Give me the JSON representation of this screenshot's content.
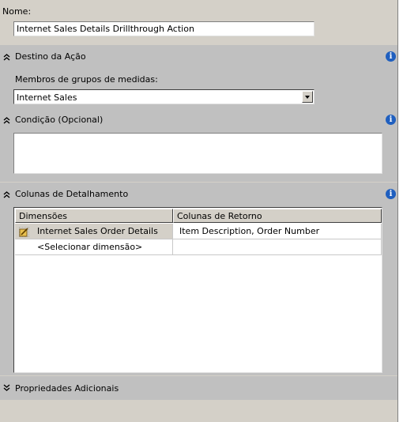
{
  "name": {
    "label": "Nome:",
    "value": "Internet Sales Details Drillthrough Action"
  },
  "target": {
    "title": "Destino da Ação",
    "field_label": "Membros de grupos de medidas:",
    "selected": "Internet Sales"
  },
  "condition": {
    "title": "Condição (Opcional)",
    "value": ""
  },
  "drillthrough": {
    "title": "Colunas de Detalhamento",
    "headers": [
      "Dimensões",
      "Colunas de Retorno"
    ],
    "rows": [
      {
        "dimension": "Internet Sales Order Details",
        "columns": "Item Description, Order Number"
      },
      {
        "dimension": "<Selecionar dimensão>",
        "columns": ""
      }
    ]
  },
  "additional": {
    "title": "Propriedades Adicionais"
  },
  "colors": {
    "section_bg": "#c0c0c0",
    "panel_bg": "#d4d0c8",
    "info_icon": "#1f5fbf"
  }
}
